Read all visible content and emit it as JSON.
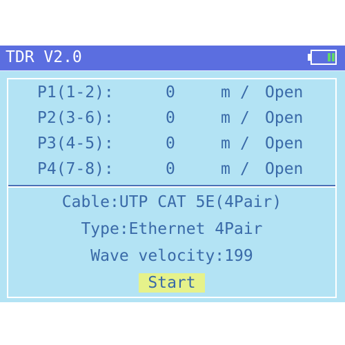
{
  "window": {
    "title": "TDR V2.0",
    "battery_icon": "battery-full-icon",
    "colors": {
      "titlebar": "#5b6ee0",
      "screen_bg": "#b3e3f4",
      "text": "#3a6aa8",
      "button_bg": "#e6f28a",
      "battery_fill": "#62d86a"
    }
  },
  "pairs": [
    {
      "label": "P1(1-2):",
      "value": "0",
      "unit": "m",
      "sep": "/",
      "status": "Open"
    },
    {
      "label": "P2(3-6):",
      "value": "0",
      "unit": "m",
      "sep": "/",
      "status": "Open"
    },
    {
      "label": "P3(4-5):",
      "value": "0",
      "unit": "m",
      "sep": "/",
      "status": "Open"
    },
    {
      "label": "P4(7-8):",
      "value": "0",
      "unit": "m",
      "sep": "/",
      "status": "Open"
    }
  ],
  "info": {
    "cable": "Cable:UTP CAT 5E(4Pair)",
    "type": "Type:Ethernet 4Pair",
    "velocity": "Wave velocity:199"
  },
  "start_button": {
    "label": "Start"
  }
}
